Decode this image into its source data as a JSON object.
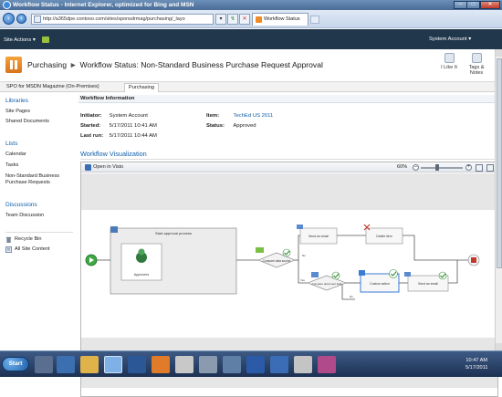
{
  "browser": {
    "window_title": "Workflow Status - Internet Explorer, optimized for Bing and MSN",
    "url": "http://a365dpe.contoso.com/sites/sponsdrmag/purchasing/_layo",
    "tab_title": "Workflow Status",
    "window_buttons": [
      "–",
      "□",
      "✕"
    ]
  },
  "sp_top": {
    "site_actions": "Site Actions",
    "user": "System Account"
  },
  "title_area": {
    "site": "Purchasing",
    "separator": "►",
    "page": "Workflow Status: Non-Standard Business Purchase Request Approval",
    "ribbon_buttons": [
      {
        "label": "I Like It",
        "icon": "like-icon"
      },
      {
        "label": "Tags & Notes",
        "icon": "tags-notes-icon"
      }
    ]
  },
  "top_nav": {
    "items": [
      "SPO for MSDN Magazine (On-Premises)",
      "Purchasing"
    ]
  },
  "left_nav": {
    "libraries_heading": "Libraries",
    "libraries": [
      "Site Pages",
      "Shared Documents"
    ],
    "lists_heading": "Lists",
    "lists": [
      "Calendar",
      "Tasks",
      "Non-Standard Business",
      "Purchase Requests"
    ],
    "discussions_heading": "Discussions",
    "discussions": [
      "Team Discussion"
    ],
    "recycle_bin": "Recycle Bin",
    "all_site_content": "All Site Content"
  },
  "workflow_info": {
    "heading": "Workflow Information",
    "initiator_label": "Initiator:",
    "initiator": "System Account",
    "item_label": "Item:",
    "item": "TechEd US 2011",
    "started_label": "Started:",
    "started": "5/17/2011 10:41 AM",
    "status_label": "Status:",
    "status": "Approved",
    "last_run_label": "Last run:",
    "last_run": "5/17/2011 10:44 AM"
  },
  "visualization": {
    "heading": "Workflow Visualization",
    "open_in_visio": "Open in Visio",
    "zoom": "60%"
  },
  "diagram": {
    "shapes": {
      "start_approval": "Start approval process",
      "approvers": "Approvers",
      "compare_data_source": "Compare data source",
      "send_email": "Send an email",
      "delete_item": "Delete item",
      "compare_document_field": "Compare document field",
      "custom_action": "Custom action",
      "send_email_2": "Send an email"
    },
    "branch_labels": {
      "yes_top": "Yes",
      "no_top": "No",
      "yes_bottom": "Yes",
      "no_bottom": "No"
    }
  },
  "taskbar": {
    "start": "Start",
    "time": "10:47 AM",
    "date": "5/17/2011"
  }
}
